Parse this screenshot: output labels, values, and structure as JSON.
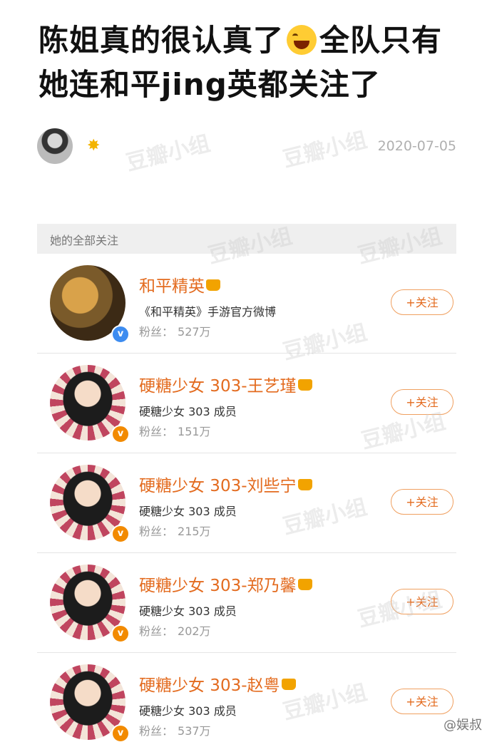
{
  "post": {
    "title_part1": "陈姐真的很认真了",
    "title_part2": "全队只有她连和平jing英都关注了",
    "date": "2020-07-05"
  },
  "section": {
    "label": "她的全部关注"
  },
  "accounts": [
    {
      "name": "和平精英",
      "desc": "《和平精英》手游官方微博",
      "fans_label": "粉丝：",
      "fans": "527万",
      "follow": "+关注",
      "verify": "v"
    },
    {
      "name": "硬糖少女 303-王艺瑾",
      "desc": "硬糖少女 303 成员",
      "fans_label": "粉丝：",
      "fans": "151万",
      "follow": "+关注",
      "verify": "v"
    },
    {
      "name": "硬糖少女 303-刘些宁",
      "desc": "硬糖少女 303 成员",
      "fans_label": "粉丝：",
      "fans": "215万",
      "follow": "+关注",
      "verify": "v"
    },
    {
      "name": "硬糖少女 303-郑乃馨",
      "desc": "硬糖少女 303 成员",
      "fans_label": "粉丝：",
      "fans": "202万",
      "follow": "+关注",
      "verify": "v"
    },
    {
      "name": "硬糖少女 303-赵粤",
      "desc": "硬糖少女 303 成员",
      "fans_label": "粉丝：",
      "fans": "537万",
      "follow": "+关注",
      "verify": "v"
    }
  ],
  "watermark": "豆瓣小组",
  "corner": "@娱叔",
  "colors": {
    "accent": "#e36b1f",
    "verify_blue": "#3d8cf0",
    "verify_orange": "#f28a00"
  }
}
